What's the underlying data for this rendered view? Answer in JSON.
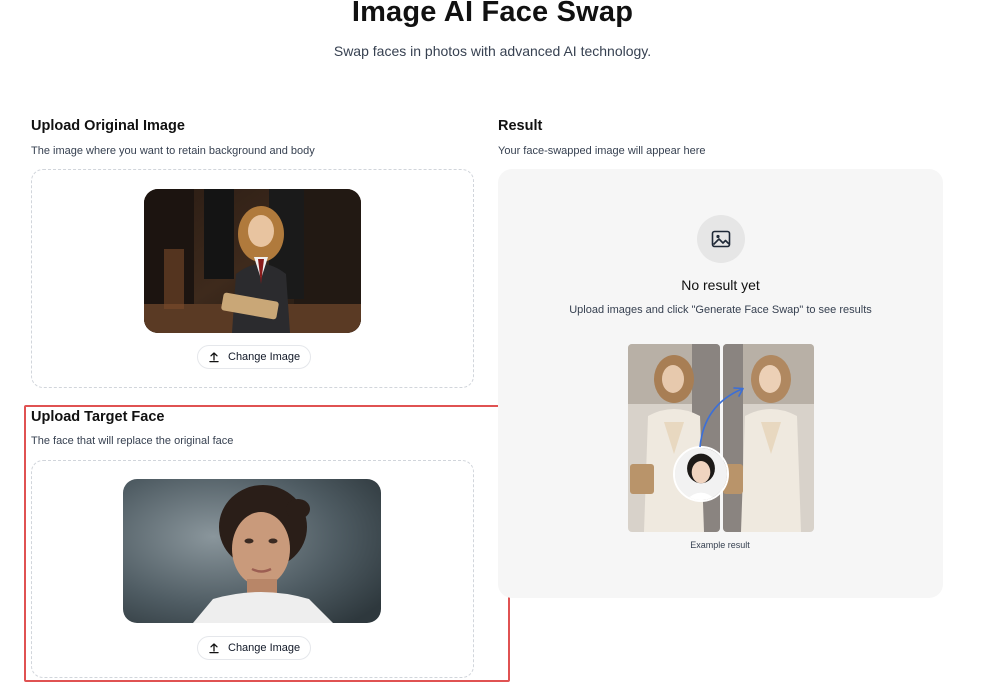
{
  "header": {
    "title": "Image AI Face Swap",
    "subtitle": "Swap faces in photos with advanced AI technology."
  },
  "original_upload": {
    "title": "Upload Original Image",
    "description": "The image where you want to retain background and body",
    "button_label": "Change Image",
    "button_icon": "upload-icon"
  },
  "target_upload": {
    "title": "Upload Target Face",
    "description": "The face that will replace the original face",
    "button_label": "Change Image",
    "button_icon": "upload-icon"
  },
  "result": {
    "title": "Result",
    "description": "Your face-swapped image will appear here",
    "placeholder_icon": "image-icon",
    "empty_title": "No result yet",
    "empty_description": "Upload images and click \"Generate Face Swap\" to see results",
    "example_caption": "Example result"
  },
  "colors": {
    "highlight_border": "#e05252",
    "panel_bg": "#f6f6f6",
    "dashed_border": "#d1d5db",
    "arrow": "#3b6fd8"
  }
}
